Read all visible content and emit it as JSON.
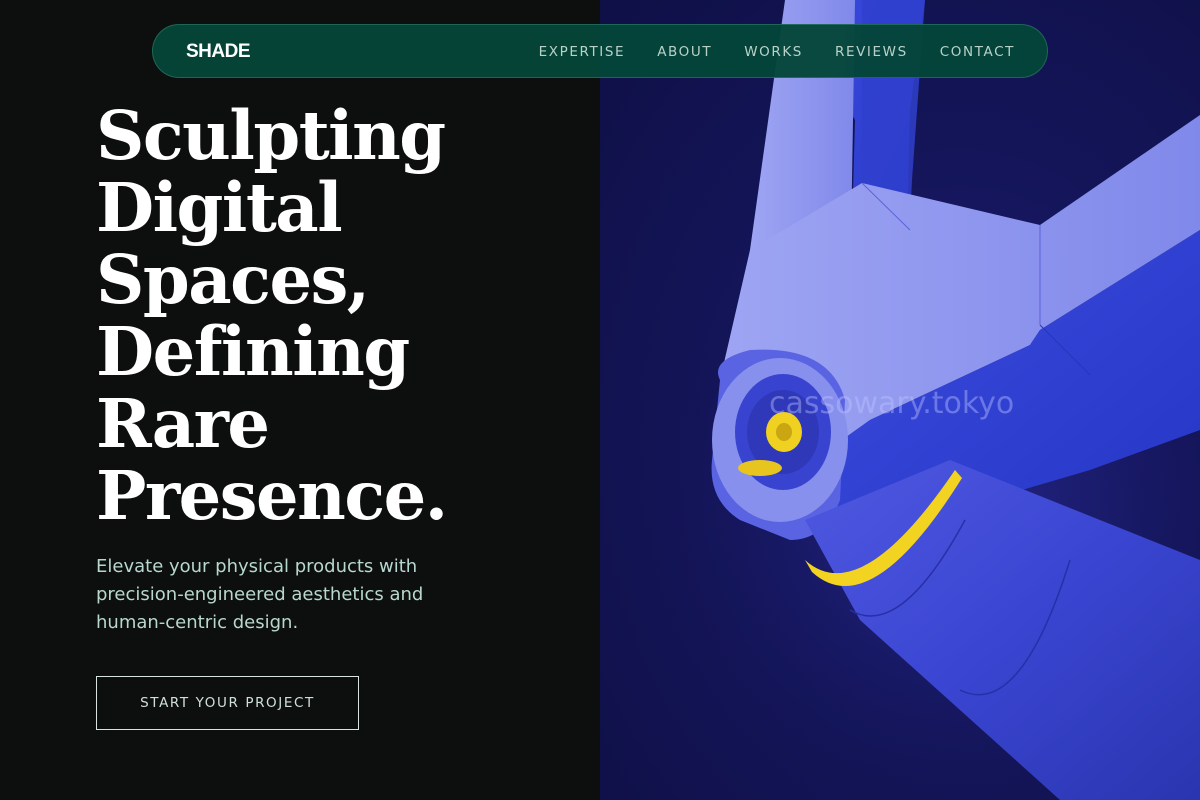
{
  "nav": {
    "brand": "SHADE",
    "links": [
      "EXPERTISE",
      "ABOUT",
      "WORKS",
      "REVIEWS",
      "CONTACT"
    ]
  },
  "hero": {
    "title_lines": [
      "Sculpting",
      "Digital",
      "Spaces,",
      "Defining",
      "Rare",
      "Presence."
    ],
    "subtitle": "Elevate your physical products with precision-engineered aesthetics and human-centric design.",
    "cta_label": "START YOUR PROJECT"
  },
  "image": {
    "subject": "blue robotic arm with yellow joint accents",
    "watermark": "cassowary.tokyo"
  },
  "colors": {
    "left_background": "#0c0f0e",
    "right_background": "#14155a",
    "nav_background": "#04463a",
    "arm_light": "#8e96ee",
    "arm_dark": "#3344d8",
    "accent_yellow": "#f0d020"
  }
}
